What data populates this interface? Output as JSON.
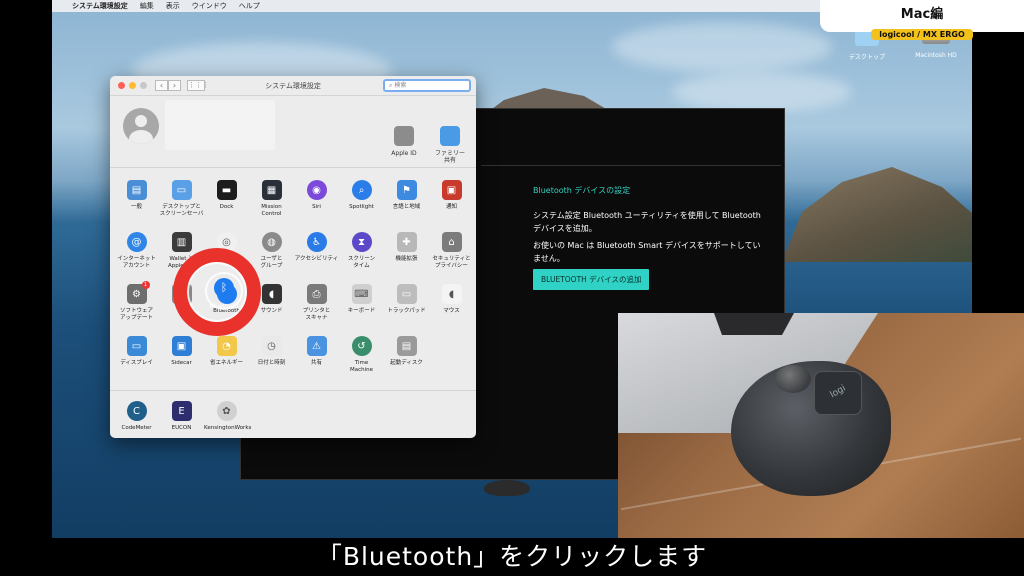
{
  "menubar": {
    "app_name": "システム環境設定",
    "items": [
      "編集",
      "表示",
      "ウインドウ",
      "ヘルプ"
    ]
  },
  "corner_label": {
    "title": "Mac編",
    "tag": "logicool / MX ERGO"
  },
  "desktop": {
    "folder_label": "デスクトップ",
    "drive_label": "Macintosh HD"
  },
  "logi_window": {
    "section_title": "Bluetooth デバイスの設定",
    "line1": "システム設定 Bluetooth ユーティリティを使用して Bluetooth デバイスを追加。",
    "line2": "お使いの Mac は Bluetooth Smart デバイスをサポートしていません。",
    "button_label": "BLUETOOTH デバイスの追加"
  },
  "prefs": {
    "window_title": "システム環境設定",
    "search_placeholder": "検索",
    "account_items": [
      {
        "label": "Apple ID",
        "icon": "apple-icon"
      },
      {
        "label": "ファミリー\n共有",
        "icon": "family-sharing-icon"
      }
    ],
    "rows": [
      [
        {
          "label": "一般",
          "icon": "general-icon",
          "color": "#4a8fd6"
        },
        {
          "label": "デスクトップと\nスクリーンセーバ",
          "icon": "desktop-icon",
          "color": "#5aa0e6"
        },
        {
          "label": "Dock",
          "icon": "dock-icon",
          "color": "#1d1d1d"
        },
        {
          "label": "Mission\nControl",
          "icon": "mission-control-icon",
          "color": "#2b2f3a"
        },
        {
          "label": "Siri",
          "icon": "siri-icon",
          "color": "#7b4ad8"
        },
        {
          "label": "Spotlight",
          "icon": "spotlight-icon",
          "color": "#2b7de9"
        },
        {
          "label": "言語と地域",
          "icon": "language-icon",
          "color": "#3c8be0"
        },
        {
          "label": "通知",
          "icon": "notifications-icon",
          "color": "#c73a2c"
        }
      ],
      [
        {
          "label": "インターネット\nアカウント",
          "icon": "internet-accounts-icon",
          "color": "#2f86e6"
        },
        {
          "label": "Wallet と\nApple Pay",
          "icon": "wallet-icon",
          "color": "#3b3b3b"
        },
        {
          "label": "Touch ID",
          "icon": "touch-id-icon",
          "color": "#f0f0f0"
        },
        {
          "label": "ユーザと\nグループ",
          "icon": "users-icon",
          "color": "#8a8a8a"
        },
        {
          "label": "アクセシビリティ",
          "icon": "accessibility-icon",
          "color": "#2a7be8"
        },
        {
          "label": "スクリーン\nタイム",
          "icon": "screen-time-icon",
          "color": "#5b49c9"
        },
        {
          "label": "機能拡張",
          "icon": "extensions-icon",
          "color": "#b8b8b8"
        },
        {
          "label": "セキュリティと\nプライバシー",
          "icon": "security-icon",
          "color": "#7c7c7c"
        }
      ],
      [
        {
          "label": "ソフトウェア\nアップデート",
          "icon": "software-update-icon",
          "color": "#6e6e6e",
          "badge": "1"
        },
        {
          "label": "ネ",
          "icon": "network-icon",
          "color": "#888888"
        },
        {
          "label": "Bluetooth",
          "icon": "bluetooth-icon",
          "color": "#1e7cf0"
        },
        {
          "label": "サウンド",
          "icon": "sound-icon",
          "color": "#333333"
        },
        {
          "label": "プリンタと\nスキャナ",
          "icon": "printer-icon",
          "color": "#7a7a7a"
        },
        {
          "label": "キーボード",
          "icon": "keyboard-icon",
          "color": "#cfcfcf"
        },
        {
          "label": "トラックパッド",
          "icon": "trackpad-icon",
          "color": "#bdbdbd"
        },
        {
          "label": "マウス",
          "icon": "mouse-icon",
          "color": "#f4f4f4"
        }
      ],
      [
        {
          "label": "ディスプレイ",
          "icon": "displays-icon",
          "color": "#3b8ad8"
        },
        {
          "label": "Sidecar",
          "icon": "sidecar-icon",
          "color": "#2f7ed6"
        },
        {
          "label": "省エネルギー",
          "icon": "energy-saver-icon",
          "color": "#f2c84b"
        },
        {
          "label": "日付と時刻",
          "icon": "date-time-icon",
          "color": "#e9e9e9"
        },
        {
          "label": "共有",
          "icon": "sharing-icon",
          "color": "#4a93e0"
        },
        {
          "label": "Time\nMachine",
          "icon": "time-machine-icon",
          "color": "#3a8d6a"
        },
        {
          "label": "起動ディスク",
          "icon": "startup-disk-icon",
          "color": "#9a9a9a"
        }
      ]
    ],
    "third_party": [
      {
        "label": "CodeMeter",
        "icon": "codemeter-icon",
        "color": "#1f5f8a"
      },
      {
        "label": "EUCON",
        "icon": "eucon-icon",
        "color": "#2e2e6e"
      },
      {
        "label": "KensingtonWorks",
        "icon": "kensington-icon",
        "color": "#d0d0d0"
      }
    ]
  },
  "subtitle": "「Bluetooth」をクリックします"
}
